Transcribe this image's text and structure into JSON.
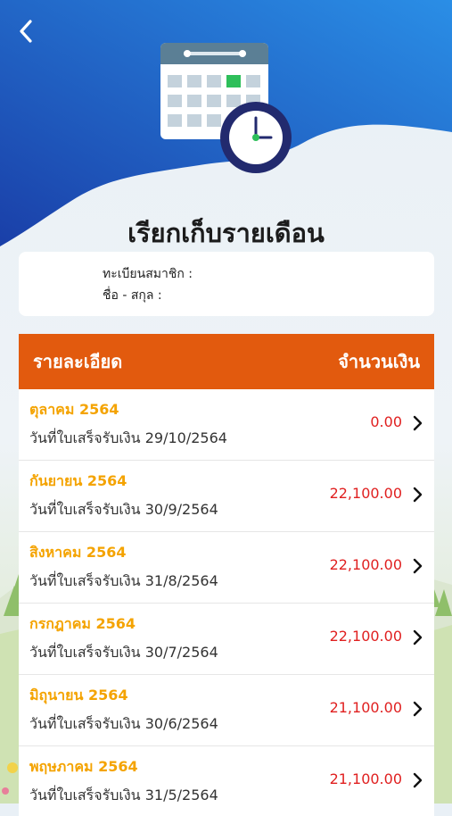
{
  "header": {
    "back_icon": "chevron-left-icon",
    "illustration_icon": "calendar-clock-icon",
    "title": "เรียกเก็บรายเดือน",
    "gradient_start": "#1a3fa8",
    "gradient_end": "#2a8ee6"
  },
  "member": {
    "id_label": "ทะเบียนสมาชิก :",
    "name_label": "ชื่อ - สกุล :"
  },
  "table": {
    "header_color": "#e25a0e",
    "col_detail": "รายละเอียด",
    "col_amount": "จำนวนเงิน",
    "receipt_prefix": "วันที่ใบเสร็จรับเงิน",
    "rows": [
      {
        "month": "ตุลาคม 2564",
        "date": "29/10/2564",
        "amount": "0.00"
      },
      {
        "month": "กันยายน 2564",
        "date": "30/9/2564",
        "amount": "22,100.00"
      },
      {
        "month": "สิงหาคม 2564",
        "date": "31/8/2564",
        "amount": "22,100.00"
      },
      {
        "month": "กรกฎาคม 2564",
        "date": "30/7/2564",
        "amount": "22,100.00"
      },
      {
        "month": "มิถุนายน 2564",
        "date": "30/6/2564",
        "amount": "21,100.00"
      },
      {
        "month": "พฤษภาคม 2564",
        "date": "31/5/2564",
        "amount": "21,100.00"
      }
    ]
  }
}
